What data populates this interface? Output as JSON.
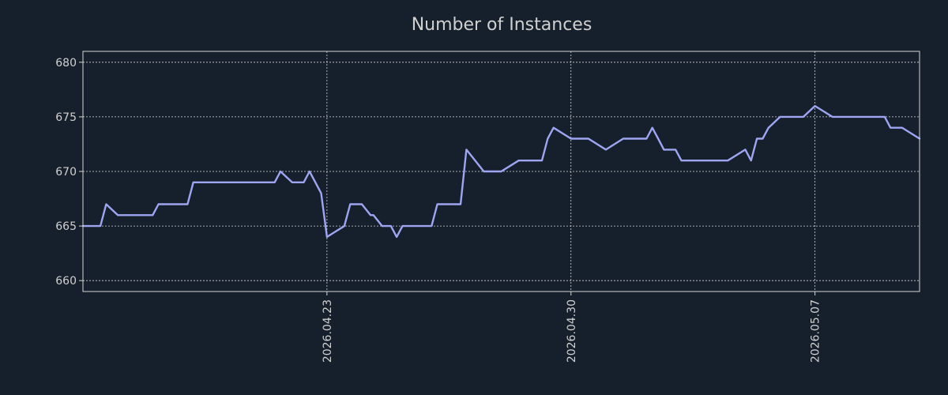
{
  "colors": {
    "background": "#161f2c",
    "plot_background": "#161f2c",
    "axis": "#d6d6d6",
    "grid": "#d6d6d6",
    "text": "#d0d0d0",
    "line": "#9ea6f2"
  },
  "chart_data": {
    "type": "line",
    "title": "Number of Instances",
    "xlabel": "",
    "ylabel": "",
    "grid": true,
    "xlim": [
      "2026-04-16",
      "2026-05-10"
    ],
    "ylim": [
      659,
      681
    ],
    "yticks": [
      660,
      665,
      670,
      675,
      680
    ],
    "xticks": [
      {
        "date": "2026-04-23",
        "label": "2026.04.23"
      },
      {
        "date": "2026-04-30",
        "label": "2026.04.30"
      },
      {
        "date": "2026-05-07",
        "label": "2026.05.07"
      }
    ],
    "series": [
      {
        "x": [
          "2026-04-16",
          "2026-04-16 12:00",
          "2026-04-16 16:00",
          "2026-04-17",
          "2026-04-17 12:00",
          "2026-04-18",
          "2026-04-18 04:00",
          "2026-04-18 12:00",
          "2026-04-19",
          "2026-04-19 04:00",
          "2026-04-19 12:00",
          "2026-04-20",
          "2026-04-20 12:00",
          "2026-04-21",
          "2026-04-21 12:00",
          "2026-04-21 16:00",
          "2026-04-22",
          "2026-04-22 08:00",
          "2026-04-22 12:00",
          "2026-04-22 16:00",
          "2026-04-22 20:00",
          "2026-04-23",
          "2026-04-23 12:00",
          "2026-04-23 16:00",
          "2026-04-24",
          "2026-04-24 06:00",
          "2026-04-24 08:00",
          "2026-04-24 14:00",
          "2026-04-24 20:00",
          "2026-04-25",
          "2026-04-25 04:00",
          "2026-04-25 12:00",
          "2026-04-26",
          "2026-04-26 04:00",
          "2026-04-26 14:00",
          "2026-04-26 20:00",
          "2026-04-27",
          "2026-04-27 12:00",
          "2026-04-27 16:00",
          "2026-04-28",
          "2026-04-28 12:00",
          "2026-04-29",
          "2026-04-29 04:00",
          "2026-04-29 08:00",
          "2026-04-29 12:00",
          "2026-04-30",
          "2026-04-30 04:00",
          "2026-04-30 12:00",
          "2026-05-01",
          "2026-05-01 12:00",
          "2026-05-02",
          "2026-05-02 04:00",
          "2026-05-02 08:00",
          "2026-05-02 12:00",
          "2026-05-02 16:00",
          "2026-05-03",
          "2026-05-03 04:00",
          "2026-05-04",
          "2026-05-04 12:00",
          "2026-05-05",
          "2026-05-05 04:00",
          "2026-05-05 08:00",
          "2026-05-05 12:00",
          "2026-05-05 16:00",
          "2026-05-06",
          "2026-05-06 12:00",
          "2026-05-06 16:00",
          "2026-05-07",
          "2026-05-07 12:00",
          "2026-05-07 16:00",
          "2026-05-08",
          "2026-05-08 12:00",
          "2026-05-09",
          "2026-05-09 04:00",
          "2026-05-09 12:00",
          "2026-05-10"
        ],
        "values": [
          665,
          665,
          667,
          666,
          666,
          666,
          667,
          667,
          667,
          669,
          669,
          669,
          669,
          669,
          669,
          670,
          669,
          669,
          670,
          669,
          668,
          664,
          665,
          667,
          667,
          666,
          666,
          665,
          665,
          664,
          665,
          665,
          665,
          667,
          667,
          667,
          672,
          670,
          670,
          670,
          671,
          671,
          671,
          673,
          674,
          673,
          673,
          673,
          672,
          673,
          673,
          673,
          674,
          673,
          672,
          672,
          671,
          671,
          671,
          672,
          671,
          673,
          673,
          674,
          675,
          675,
          675,
          676,
          675,
          675,
          675,
          675,
          675,
          674,
          674,
          673
        ]
      }
    ]
  }
}
